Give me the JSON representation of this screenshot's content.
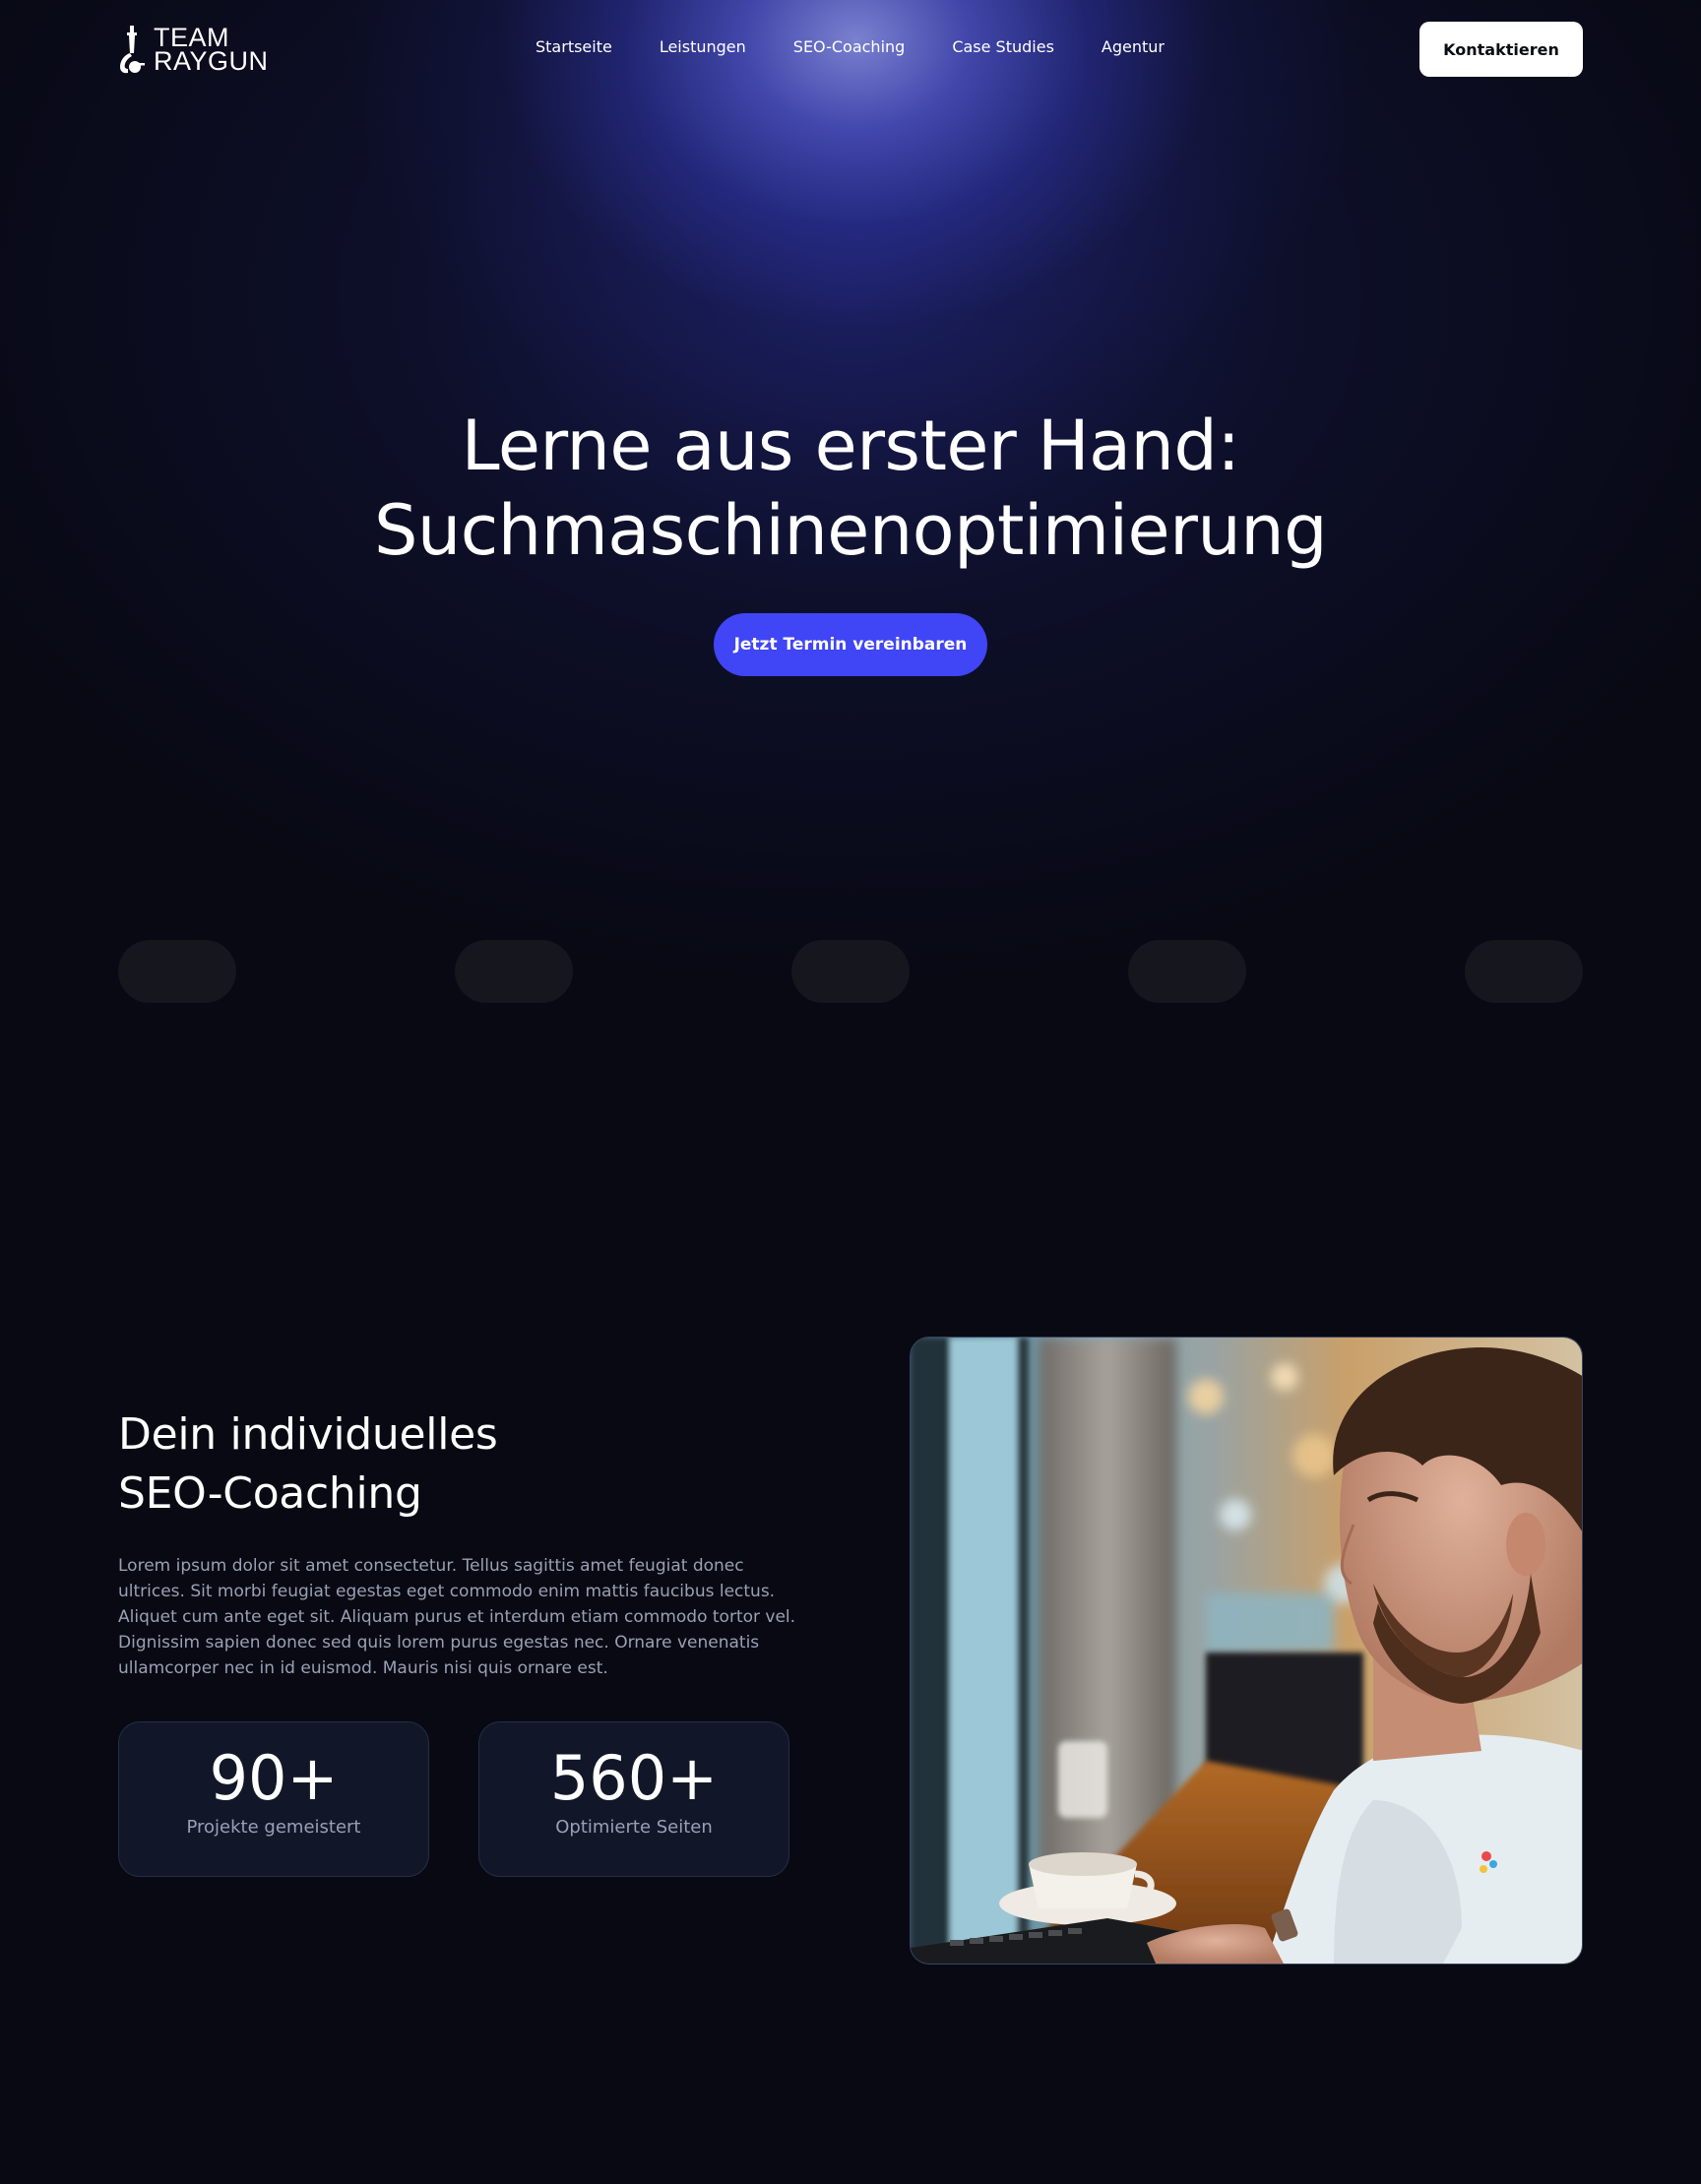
{
  "brand": {
    "line1": "TEAM",
    "line2": "RAYGUN"
  },
  "nav": {
    "links": [
      "Startseite",
      "Leistungen",
      "SEO-Coaching",
      "Case Studies",
      "Agentur"
    ],
    "contact_label": "Kontaktieren"
  },
  "hero": {
    "title_line1": "Lerne aus erster Hand:",
    "title_line2": "Suchmaschinenoptimierung",
    "cta_label": "Jetzt Termin vereinbaren"
  },
  "coaching": {
    "title_line1": "Dein individuelles",
    "title_line2": "SEO-Coaching",
    "text": "Lorem ipsum dolor sit amet consectetur. Tellus sagittis amet feugiat donec ultrices. Sit morbi feugiat egestas eget commodo enim mattis faucibus lectus. Aliquet cum ante eget sit. Aliquam purus et interdum etiam commodo tortor vel. Dignissim sapien donec sed quis lorem purus egestas nec. Ornare venenatis ullamcorper nec in id euismod. Mauris nisi quis ornare est.",
    "stats": [
      {
        "value": "90+",
        "label": "Projekte gemeistert"
      },
      {
        "value": "560+",
        "label": "Optimierte Seiten"
      }
    ]
  },
  "colors": {
    "background": "#080913",
    "accent": "#4045f5",
    "card": "#111728"
  }
}
